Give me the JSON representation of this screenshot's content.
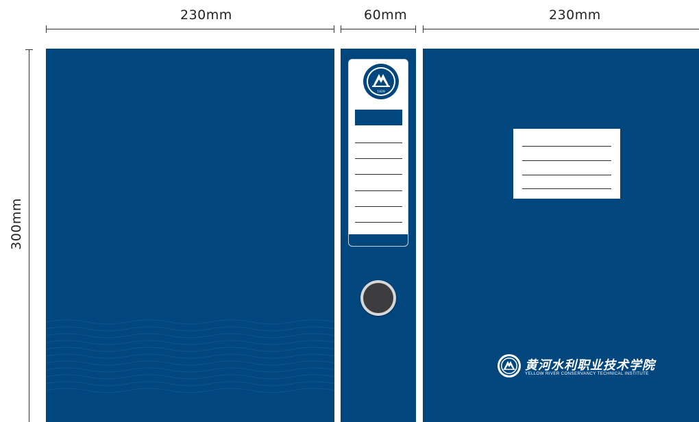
{
  "dimensions": {
    "front_width": "230mm",
    "spine_width": "60mm",
    "back_width": "230mm",
    "height": "300mm"
  },
  "spine": {
    "emblem_year": "1929",
    "line_count": 6
  },
  "front_label": {
    "line_count": 4
  },
  "logo": {
    "chinese_name": "黄河水利职业技术学院",
    "english_name": "YELLOW RIVER CONSERVANCY TECHNICAL INSTITUTE",
    "emblem_year": "1929"
  },
  "colors": {
    "cover_blue": "#02467e",
    "ring": "#3d3d3f",
    "label": "#ffffff"
  }
}
